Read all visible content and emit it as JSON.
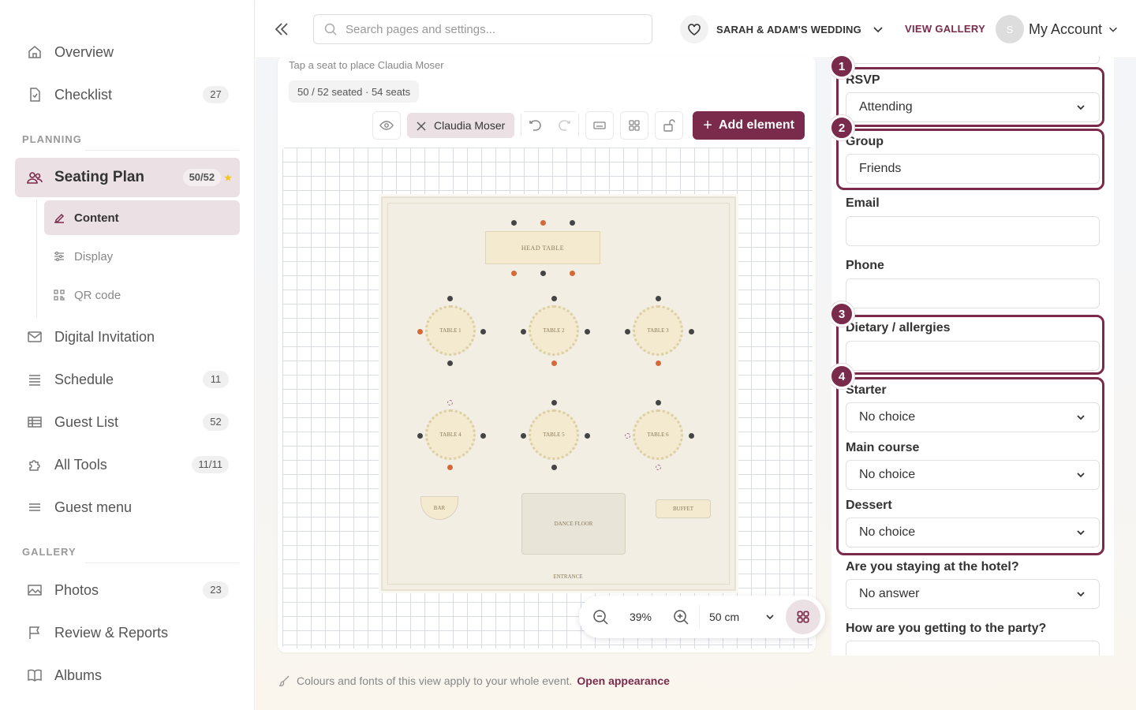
{
  "sidebar": {
    "items": [
      {
        "label": "Overview",
        "icon": "home-icon"
      },
      {
        "label": "Checklist",
        "icon": "checklist-icon",
        "badge": "27"
      },
      {
        "label": "Seating Plan",
        "icon": "people-icon",
        "badge": "50/52"
      },
      {
        "label": "Digital Invitation",
        "icon": "mail-icon"
      },
      {
        "label": "Schedule",
        "icon": "list-icon",
        "badge": "11"
      },
      {
        "label": "Guest List",
        "icon": "table-icon",
        "badge": "52"
      },
      {
        "label": "All Tools",
        "icon": "puzzle-icon",
        "badge": "11/11"
      },
      {
        "label": "Guest menu",
        "icon": "menu-icon"
      },
      {
        "label": "Photos",
        "icon": "image-icon",
        "badge": "23"
      },
      {
        "label": "Review & Reports",
        "icon": "flag-icon"
      },
      {
        "label": "Albums",
        "icon": "book-icon"
      }
    ],
    "sections": {
      "planning": "PLANNING",
      "gallery": "GALLERY"
    },
    "sub_items": [
      {
        "label": "Content",
        "icon": "edit-icon"
      },
      {
        "label": "Display",
        "icon": "sliders-icon"
      },
      {
        "label": "QR code",
        "icon": "qr-icon"
      }
    ]
  },
  "header": {
    "search_placeholder": "Search pages and settings...",
    "event_name": "SARAH & ADAM'S WEDDING",
    "view_gallery": "VIEW GALLERY",
    "avatar_initial": "S",
    "account_label": "My Account"
  },
  "canvas": {
    "hint": "Tap a seat to place Claudia Moser",
    "seated_summary": "50 / 52 seated · 54 seats",
    "selected_guest": "Claudia Moser",
    "add_element": "Add element",
    "head_table": "HEAD TABLE",
    "tables": [
      "TABLE 1",
      "TABLE 2",
      "TABLE 3",
      "TABLE 4",
      "TABLE 5",
      "TABLE 6"
    ],
    "bar": "BAR",
    "buffet": "BUFFET",
    "dance_floor": "DANCE FLOOR",
    "entrance": "ENTRANCE",
    "zoom": "39%",
    "grid_size": "50 cm"
  },
  "footer": {
    "note": "Colours and fonts of this view apply to your whole event.",
    "link": "Open appearance"
  },
  "panel": {
    "rsvp_label": "RSVP",
    "rsvp_value": "Attending",
    "group_label": "Group",
    "group_value": "Friends",
    "email_label": "Email",
    "email_value": "",
    "phone_label": "Phone",
    "phone_value": "",
    "dietary_label": "Dietary / allergies",
    "dietary_value": "",
    "starter_label": "Starter",
    "starter_value": "No choice",
    "main_label": "Main course",
    "main_value": "No choice",
    "dessert_label": "Dessert",
    "dessert_value": "No choice",
    "hotel_label": "Are you staying at the hotel?",
    "hotel_value": "No answer",
    "travel_label": "How are you getting to the party?",
    "highlights": [
      "1",
      "2",
      "3",
      "4"
    ]
  },
  "colors": {
    "accent": "#7a2a4a",
    "accent_soft": "#ebe1e5",
    "star": "#f5c518"
  }
}
